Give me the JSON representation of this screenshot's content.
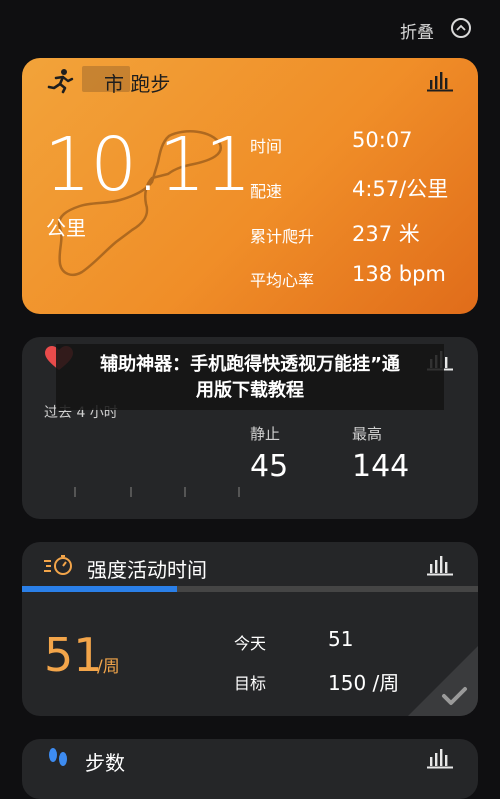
{
  "header": {
    "collapse_label": "折叠"
  },
  "run_card": {
    "title": "市 跑步",
    "distance": "10.11",
    "distance_unit": "公里",
    "stats": [
      {
        "label": "时间",
        "value": "50:07"
      },
      {
        "label": "配速",
        "value": "4:57/公里"
      },
      {
        "label": "累计爬升",
        "value": "237 米"
      },
      {
        "label": "平均心率",
        "value": "138 bpm"
      }
    ]
  },
  "heart_card": {
    "period": "过去 4 小时",
    "resting_label": "静止",
    "resting_value": "45",
    "max_label": "最高",
    "max_value": "144"
  },
  "overlay": {
    "line1": "辅助神器：手机跑得快透视万能挂”通",
    "line2": "用版下载教程"
  },
  "intensity_card": {
    "title": "强度活动时间",
    "value": "51",
    "value_unit": "/周",
    "progress_fraction": 0.34,
    "today_label": "今天",
    "today_value": "51",
    "goal_label": "目标",
    "goal_value": "150 /周"
  },
  "steps_card": {
    "title": "步数"
  },
  "colors": {
    "accent_orange": "#f08e28",
    "progress_blue": "#2a7fe8",
    "card_dark": "#252628",
    "heart_red": "#e94b4b"
  }
}
